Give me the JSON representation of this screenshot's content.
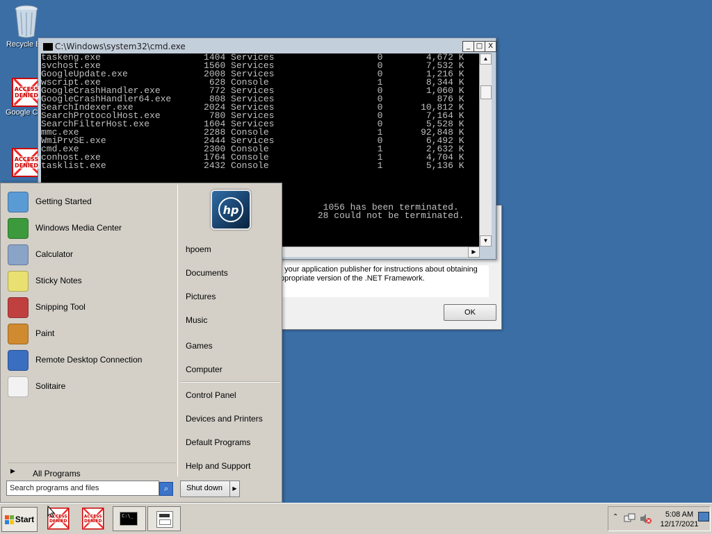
{
  "desktop": {
    "icons": [
      {
        "label": "Recycle Bin"
      },
      {
        "label": "Google Chrome",
        "badge": "ACCESS DENIED"
      },
      {
        "label": "",
        "badge": "ACCESS DENIED"
      }
    ]
  },
  "cmd": {
    "title": "C:\\Windows\\system32\\cmd.exe",
    "lines": [
      "taskeng.exe                   1404 Services                   0        4,672 K",
      "svchost.exe                   1560 Services                   0        7,532 K",
      "GoogleUpdate.exe              2008 Services                   0        1,216 K",
      "wscript.exe                    628 Console                    1        8,344 K",
      "GoogleCrashHandler.exe         772 Services                   0        1,060 K",
      "GoogleCrashHandler64.exe       808 Services                   0          876 K",
      "SearchIndexer.exe             2024 Services                   0       10,812 K",
      "SearchProtocolHost.exe         780 Services                   0        7,164 K",
      "SearchFilterHost.exe          1604 Services                   0        5,528 K",
      "mmc.exe                       2288 Console                    1       92,848 K",
      "WmiPrvSE.exe                  2444 Services                   0        6,492 K",
      "cmd.exe                       2300 Console                    1        2,632 K",
      "conhost.exe                   1764 Console                    1        4,704 K",
      "tasklist.exe                  2432 Console                    1        5,136 K",
      "",
      "",
      "",
      "",
      "                                                    1056 has been terminated.",
      "                                                   28 could not be terminated."
    ],
    "minimize": "_",
    "maximize": "□",
    "close": "X"
  },
  "dialog": {
    "message_line1": "t your application publisher for instructions about obtaining",
    "message_line2": "ppropriate version of the .NET Framework.",
    "ok_label": "OK"
  },
  "startmenu": {
    "programs": [
      {
        "label": "Getting Started",
        "icon": "getting-started-icon",
        "color": "#5b9bd5"
      },
      {
        "label": "Windows Media Center",
        "icon": "media-center-icon",
        "color": "#3c9a3c"
      },
      {
        "label": "Calculator",
        "icon": "calculator-icon",
        "color": "#8aa4c8"
      },
      {
        "label": "Sticky Notes",
        "icon": "sticky-notes-icon",
        "color": "#e8e070"
      },
      {
        "label": "Snipping Tool",
        "icon": "snipping-tool-icon",
        "color": "#c04040"
      },
      {
        "label": "Paint",
        "icon": "paint-icon",
        "color": "#d08a30"
      },
      {
        "label": "Remote Desktop Connection",
        "icon": "remote-desktop-icon",
        "color": "#3a6ec0"
      },
      {
        "label": "Solitaire",
        "icon": "solitaire-icon",
        "color": "#f2f2f2"
      }
    ],
    "all_programs": "All Programs",
    "search_placeholder": "Search programs and files",
    "right": {
      "user": "hpoem",
      "documents": "Documents",
      "pictures": "Pictures",
      "music": "Music",
      "games": "Games",
      "computer": "Computer",
      "control_panel": "Control Panel",
      "devices": "Devices and Printers",
      "default_programs": "Default Programs",
      "help": "Help and Support"
    },
    "hp_logo": "hp",
    "shutdown": "Shut down"
  },
  "taskbar": {
    "start": "Start",
    "denied_badge": "ACCESS DENIED",
    "cmd_icon_text": "C:\\_",
    "time": "5:08 AM",
    "date": "12/17/2021"
  }
}
